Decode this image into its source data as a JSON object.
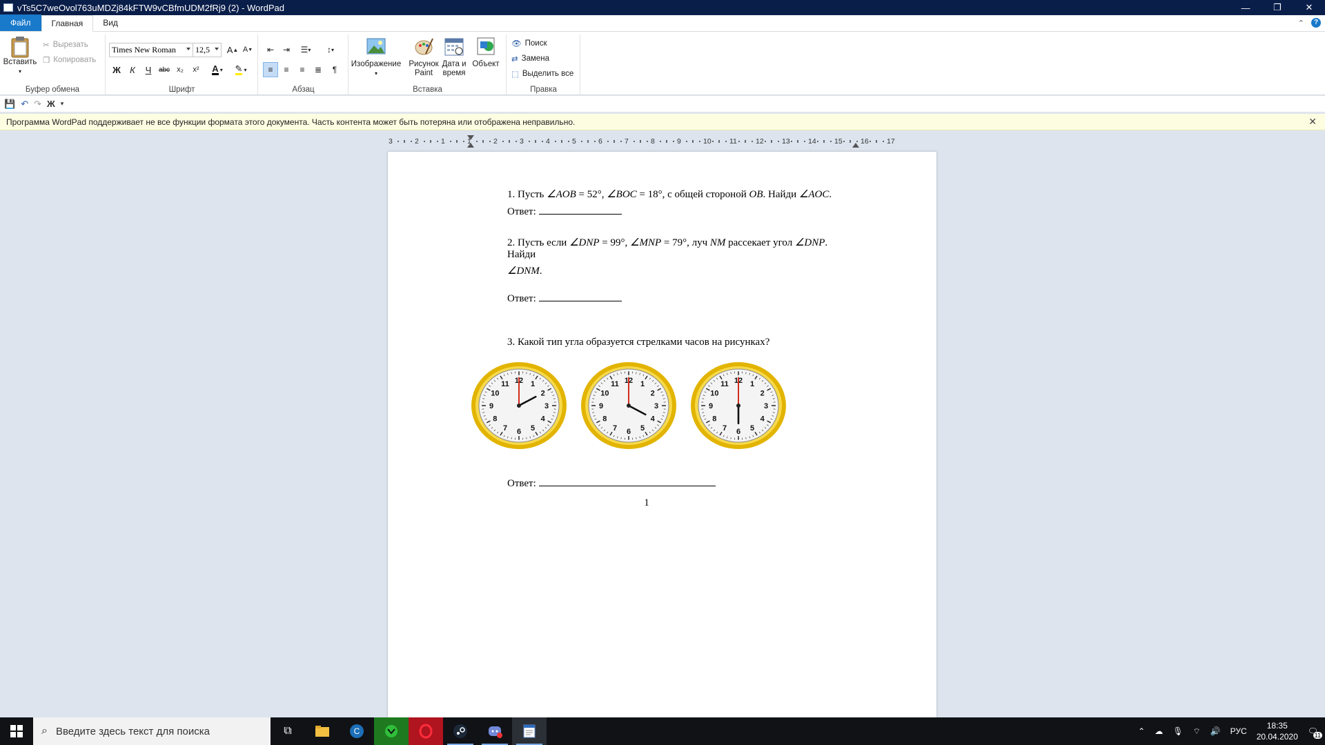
{
  "window": {
    "title": "vTs5C7weOvol763uMDZj84kFTW9vCBfmUDM2fRj9 (2) - WordPad",
    "minimize": "—",
    "restore": "❐",
    "close": "✕"
  },
  "tabs": [
    {
      "label": "Файл"
    },
    {
      "label": "Главная"
    },
    {
      "label": "Вид"
    }
  ],
  "ribbon": {
    "clipboard": {
      "label": "Буфер обмена",
      "paste": "Вставить",
      "cut": "Вырезать",
      "copy": "Копировать"
    },
    "font": {
      "label": "Шрифт",
      "family": "Times New Roman",
      "size": "12,5",
      "bold": "Ж",
      "italic": "К",
      "underline": "Ч",
      "strike": "abc",
      "subscript": "x₂",
      "superscript": "x²",
      "color": "A"
    },
    "paragraph": {
      "label": "Абзац"
    },
    "insert": {
      "label": "Вставка",
      "image": "Изображение",
      "paint_line1": "Рисунок",
      "paint_line2": "Paint",
      "datetime_line1": "Дата и",
      "datetime_line2": "время",
      "object": "Объект"
    },
    "editing": {
      "label": "Правка",
      "find": "Поиск",
      "replace": "Замена",
      "select_all": "Выделить все"
    }
  },
  "infobar": {
    "message": "Программа WordPad поддерживает не все функции формата этого документа. Часть контента может быть потеряна или отображена неправильно.",
    "close": "✕"
  },
  "ruler": {
    "labels": [
      "3",
      "2",
      "1",
      "1",
      "2",
      "3",
      "4",
      "5",
      "6",
      "7",
      "8",
      "9",
      "10",
      "11",
      "12",
      "13",
      "14",
      "15",
      "16",
      "17"
    ]
  },
  "document": {
    "q1_prefix": "1. Пусть",
    "q1_math1": "∠AOB",
    "q1_eq1": "= 52°,",
    "q1_math2": "∠BOC",
    "q1_eq2": "= 18°, с общей стороной",
    "q1_math3": "OB",
    "q1_find": ". Найди",
    "q1_math4": "∠AOC",
    "q1_end": ".",
    "answer_label": "Ответ:",
    "q2_prefix": "2. Пусть  если",
    "q2_math1": "∠DNP",
    "q2_eq1": "= 99°,",
    "q2_math2": "∠MNP",
    "q2_eq2": "= 79°, луч",
    "q2_math3": "NM",
    "q2_mid": "рассекает угол",
    "q2_math4": "∠DNP",
    "q2_end": ".",
    "q2_find": "Найди",
    "q2_math5": "∠DNM",
    "q2_end2": ".",
    "q3": "3. Какой тип угла образуется  стрелками часов на рисунках?",
    "page_number": "1"
  },
  "clocks": [
    {
      "hour_angle": 60,
      "minute_angle": 0
    },
    {
      "hour_angle": 120,
      "minute_angle": 0
    },
    {
      "hour_angle": 180,
      "minute_angle": 0
    }
  ],
  "clock_numbers": [
    "12",
    "1",
    "2",
    "3",
    "4",
    "5",
    "6",
    "7",
    "8",
    "9",
    "10",
    "11"
  ],
  "taskbar": {
    "search_placeholder": "Введите здесь текст для поиска",
    "language": "РУС",
    "time": "18:35",
    "date": "20.04.2020",
    "notifications": "11"
  }
}
